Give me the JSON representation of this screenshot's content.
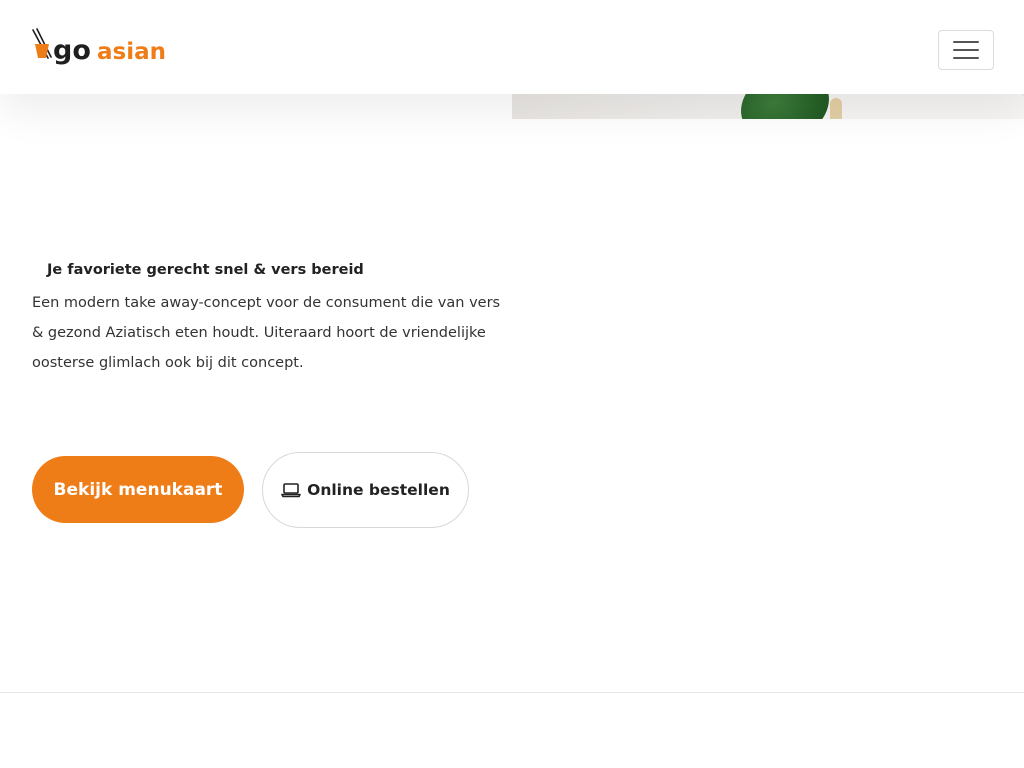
{
  "brand": {
    "logo_text_primary": "go",
    "logo_text_secondary": "asian",
    "accent_color": "#ef7d17",
    "dark_color": "#1f1f1f"
  },
  "header": {
    "menu_icon": "hamburger-icon"
  },
  "hero": {
    "tagline": "Je favoriete gerecht snel & vers bereid",
    "intro": "Een modern take away-concept voor de consument die van vers & gezond Aziatisch eten houdt. Uiteraard hoort de vriendelijke oosterse glimlach ook bij dit concept.",
    "primary_button": "Bekijk menukaart",
    "secondary_button": "Online bestellen",
    "secondary_button_icon": "laptop-icon"
  }
}
